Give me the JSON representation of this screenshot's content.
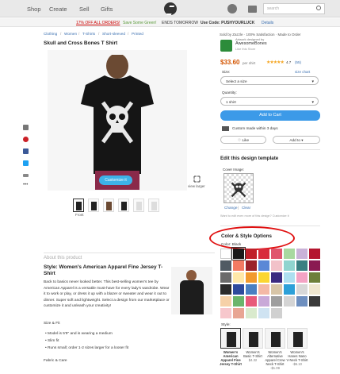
{
  "nav": {
    "shop": "Shop",
    "create": "Create",
    "sell": "Sell",
    "gifts": "Gifts",
    "search_placeholder": "search"
  },
  "promo": {
    "deal": "17% OFF ALL ORDERS!",
    "save": "Save Some Green!",
    "ends": "ENDS TOMORROW",
    "code": "Use Code: PUSHYOURLUCK",
    "details": "Details"
  },
  "breadcrumb": [
    "Clothing",
    "Women",
    "T-Shirts",
    "Short-sleeved",
    "Printed"
  ],
  "product": {
    "title": "Skull and Cross Bones T Shirt",
    "customize": "Customize it",
    "view_larger": "view larger",
    "thumb_label": "Front"
  },
  "seller": {
    "sold_by": "Sold by Zazzle · 100% Satisfaction · Made to Order",
    "store_by": "Artwork designed by",
    "store_name": "AwesomeBones",
    "store_sub": "Like this Store",
    "price": "$33.60",
    "per": "per shirt",
    "stars": "★★★★★",
    "rating": "4.7",
    "reviews": "(55)"
  },
  "options": {
    "size_label": "Size:",
    "size_chart": "size chart",
    "size_value": "Select a size",
    "qty_label": "Quantity:",
    "qty_value": "1 shirt",
    "add_to_cart": "Add to Cart",
    "custom_made": "Custom made within 3 days",
    "like": "Like",
    "add_to": "Add to"
  },
  "edit": {
    "title": "Edit this design template",
    "cover_label": "Cover Image:",
    "change": "Change",
    "clear": "Clear",
    "hint": "Want to edit even more of this design? Customize it"
  },
  "color_style": {
    "title": "Color & Style Options",
    "color_label": "Color: Black",
    "swatches": [
      "#ffffff",
      "#1a1a1a",
      "#c0202a",
      "#d82b3c",
      "#e0556e",
      "#a8d8a0",
      "#c9b2d8",
      "#b4152f",
      "#505a63",
      "#f27b62",
      "#9b2228",
      "#5a88d6",
      "#f2c2c9",
      "#8fd4cf",
      "#3a7f82",
      "#8a1a52",
      "#6b6b6b",
      "#ffe8a8",
      "#f29a2e",
      "#fbd631",
      "#3b2a80",
      "#aedff0",
      "#f4a3c4",
      "#6e7f3a",
      "#2b2b2b",
      "#2e4a9c",
      "#4a7fc2",
      "#f4b9a6",
      "#d7c5a7",
      "#2da0d8",
      "#d8d8d8",
      "#efe6cf",
      "#f6d1a8",
      "#6bb56b",
      "#e85a7a",
      "#c9a9d8",
      "#9e9e9e",
      "#d4d4d4",
      "#6e8fbf",
      "#3a3a3a",
      "#f7c7cc",
      "#e8a593",
      "#d9eacd",
      "#cfe3f2",
      "#d0d0d0"
    ],
    "style_label": "Style:",
    "styles": [
      {
        "name": "Women's American Apparel Fine Jersey T-Shirt",
        "price": ""
      },
      {
        "name": "Women's Basic T-Shirt",
        "price": "$4.32"
      },
      {
        "name": "Women's Alternative Apparel Crew Neck T-Shirt",
        "price": "-$1.09"
      },
      {
        "name": "Women's Hanes Nano V-Neck T-Shirt",
        "price": "-$6.10"
      }
    ]
  },
  "about": {
    "heading": "About this product",
    "style_title": "Style: Women's American Apparel Fine Jersey T-Shirt",
    "body": "Back to basics never looked better. This best-selling women's tee by American Apparel is a versatile must-have for every lady's wardrobe. Wear it to work or play, or dress it up with a blazer or sweater and wear it out to dinner. Super soft and lightweight. Select a design from our marketplace or customize it and unleash your creativity!",
    "size_fit": "Size & Fit",
    "bullets": [
      "Model is 5'9\" and is wearing a medium",
      "Slim fit",
      "Runs small; order 1-2 sizes larger for a looser fit"
    ],
    "fabric": "Fabric & Care"
  }
}
